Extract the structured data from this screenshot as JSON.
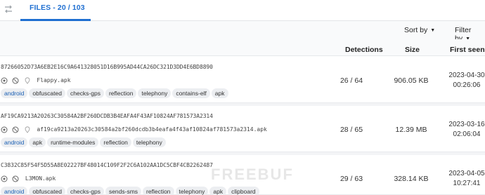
{
  "tabs": {
    "files_label": "FILES - 20 / 103"
  },
  "toolbar": {
    "sort_by": "Sort by",
    "filter_by": "Filter by"
  },
  "columns": {
    "detections": "Detections",
    "size": "Size",
    "first_seen": "First seen"
  },
  "rows": [
    {
      "hash": "87266052D73A6EB2E16C9A641328051D16B995AD44CA26DC321D3DD4E6BD8890",
      "name": "Flappy.apk",
      "tags": [
        "android",
        "obfuscated",
        "checks-gps",
        "reflection",
        "telephony",
        "contains-elf",
        "apk"
      ],
      "detections": "26 / 64",
      "size": "906.05 KB",
      "date": "2023-04-30",
      "time": "00:26:06"
    },
    {
      "hash": "AF19CA9213A20263C30584A2BF260DCDB3B4EAFA4F43AF10824AF781573A2314",
      "name": "af19ca9213a20263c30584a2bf260dcdb3b4eafa4f43af10824af781573a2314.apk",
      "tags": [
        "android",
        "apk",
        "runtime-modules",
        "reflection",
        "telephony"
      ],
      "detections": "28 / 65",
      "size": "12.39 MB",
      "date": "2023-03-16",
      "time": "02:06:04"
    },
    {
      "hash": "C3832C85F54F5D55A8E02227BF48014C109F2F2C6A102AA1DC5CBF4CB2262487",
      "name": "L3MON.apk",
      "tags": [
        "android",
        "obfuscated",
        "checks-gps",
        "sends-sms",
        "reflection",
        "telephony",
        "apk",
        "clipboard"
      ],
      "detections": "29 / 63",
      "size": "328.14 KB",
      "date": "2023-04-05",
      "time": "10:27:41"
    }
  ],
  "watermark": "FREEBUF",
  "colors": {
    "accent": "#1f6fd1",
    "tag_bg": "#eceef1",
    "tag_blue": "#1a5fb4"
  },
  "icons": [
    "swap-arrows-icon",
    "settings-icon",
    "no-entry-icon",
    "map-pin-icon",
    "caret-down-icon"
  ]
}
